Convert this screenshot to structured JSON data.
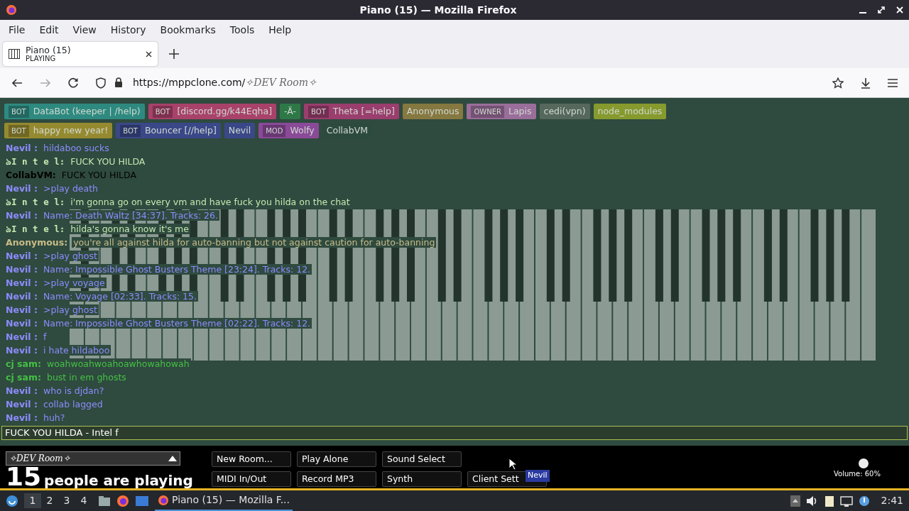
{
  "window": {
    "title": "Piano (15) — Mozilla Firefox"
  },
  "menu": [
    "File",
    "Edit",
    "View",
    "History",
    "Bookmarks",
    "Tools",
    "Help"
  ],
  "tabs": [
    {
      "title": "Piano (15)",
      "subtitle": "PLAYING",
      "selected": true
    }
  ],
  "address_bar": {
    "url": "https://mppclone.com/",
    "path": "✧DEV Room✧"
  },
  "user_rows": [
    {
      "users": [
        {
          "badge": "BOT",
          "name": "DataBot (keeper | /help)",
          "color": "#2e8a80"
        },
        {
          "badge": "BOT",
          "name": "[discord.gg/k44Eqha]",
          "color": "#a8426a"
        },
        {
          "name": "-Ä-",
          "color": "#2e7848"
        },
        {
          "badge": "BOT",
          "name": "Theta [=help]",
          "color": "#9a3e6e"
        },
        {
          "name": "Anonymous",
          "color": "#857840"
        },
        {
          "badge": "OWNER",
          "name": "Lapis",
          "color": "#9a6e9a"
        },
        {
          "name": "cedi(vpn)",
          "color": "#56685c"
        },
        {
          "name": "node_modules",
          "color": "#869a2e"
        }
      ]
    },
    {
      "users": [
        {
          "badge": "BOT",
          "name": "happy new year!",
          "color": "#968a30"
        },
        {
          "badge": "BOT",
          "name": "Bouncer [//help]",
          "color": "#3a4888"
        },
        {
          "name": "Nevil",
          "color": "#3a4888"
        },
        {
          "badge": "MOD",
          "name": "Wolfy",
          "color": "#8a4a98"
        },
        {
          "name": "CollabVM",
          "color": "#2d4a3e"
        }
      ]
    }
  ],
  "chat": [
    {
      "name": "Nevil :",
      "text": "hildaboo sucks",
      "color": "#8c8cfe"
    },
    {
      "name": "ঌI n t e l:",
      "text": "FUCK YOU HILDA",
      "color": "#c4e8b0"
    },
    {
      "name": "CollabVM:",
      "text": "FUCK YOU HILDA",
      "color": "#000000"
    },
    {
      "name": "Nevil :",
      "text": ">play death",
      "color": "#8c8cfe"
    },
    {
      "name": "ঌI n t e l:",
      "text": "i'm gonna go on every vm and have fuck you hilda on the chat",
      "color": "#c4e8b0"
    },
    {
      "name": "Nevil :",
      "text": "Name: Death Waltz [34:37]. Tracks: 26.",
      "color": "#8c8cfe"
    },
    {
      "name": "ঌI n t e l:",
      "text": "hilda's gonna know it's me",
      "color": "#c4e8b0"
    },
    {
      "name": "Anonymous:",
      "text": "you're all against hilda for auto-banning but not against caution for auto-banning",
      "color": "#c8bc88"
    },
    {
      "name": "Nevil :",
      "text": ">play ghost",
      "color": "#8c8cfe"
    },
    {
      "name": "Nevil :",
      "text": "Name: Impossible Ghost Busters Theme [23:24]. Tracks: 12.",
      "color": "#8c8cfe"
    },
    {
      "name": "Nevil :",
      "text": ">play voyage",
      "color": "#8c8cfe"
    },
    {
      "name": "Nevil :",
      "text": "Name: Voyage [02:33]. Tracks: 15.",
      "color": "#8c8cfe"
    },
    {
      "name": "Nevil :",
      "text": ">play ghost",
      "color": "#8c8cfe"
    },
    {
      "name": "Nevil :",
      "text": "Name: Impossible Ghost Busters Theme [02:22]. Tracks: 12.",
      "color": "#8c8cfe"
    },
    {
      "name": "Nevil :",
      "text": "f",
      "color": "#8c8cfe"
    },
    {
      "name": "Nevil :",
      "text": "i hate hildaboo",
      "color": "#8c8cfe"
    },
    {
      "name": "cj sam:",
      "text": "woahwoahwoahoawhowahowah",
      "color": "#44c044"
    },
    {
      "name": "cj sam:",
      "text": "bust in em ghosts",
      "color": "#44c044"
    },
    {
      "name": "Nevil :",
      "text": "who is djdan?",
      "color": "#8c8cfe"
    },
    {
      "name": "Nevil :",
      "text": "collab lagged",
      "color": "#8c8cfe"
    },
    {
      "name": "Nevil :",
      "text": "huh?",
      "color": "#8c8cfe"
    }
  ],
  "chat_input": {
    "value": "FUCK YOU HILDA - Intel f"
  },
  "room": {
    "name": "✧DEV Room✧",
    "count": "15",
    "caption": "people are playing"
  },
  "buttons": [
    "New Room...",
    "Play Alone",
    "Sound Select",
    "MIDI In/Out",
    "Record MP3",
    "Synth",
    "Client Sett"
  ],
  "cursor_label": "Nevil",
  "volume": {
    "level": 0.6,
    "label": "Volume: 60%"
  },
  "taskbar": {
    "workspaces": [
      {
        "label": "1",
        "selected": true
      },
      {
        "label": "2",
        "selected": false
      },
      {
        "label": "3",
        "selected": false
      },
      {
        "label": "4",
        "selected": false
      }
    ],
    "window": "Piano (15) — Mozilla F...",
    "clock": "2:41"
  }
}
